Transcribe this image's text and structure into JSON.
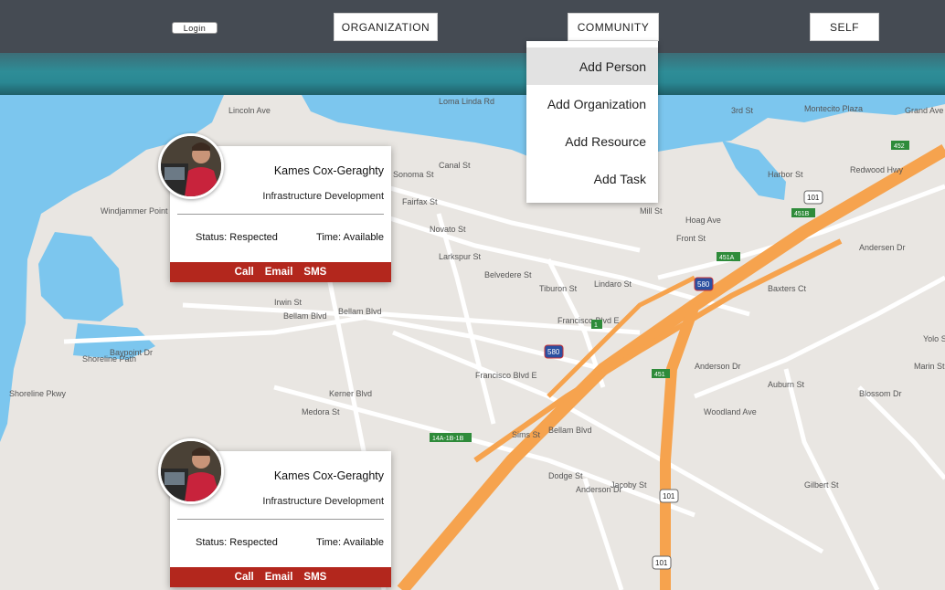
{
  "nav": {
    "self_label": "SELF",
    "community_label": "COMMUNITY",
    "organization_label": "ORGANIZATION",
    "login_label": "Login"
  },
  "community_menu": {
    "items": [
      "Add Person",
      "Add Organization",
      "Add Resource",
      "Add Task"
    ],
    "active_item": "Add Person"
  },
  "map": {
    "street_labels": [
      "Bellam Blvd",
      "Bellam Blvd",
      "Francisco Blvd E",
      "Francisco Blvd E",
      "Kerner Blvd",
      "Medora St",
      "Sims St",
      "Dodge St",
      "Jacoby St",
      "Anderson Dr",
      "Anderson Dr",
      "Andersen Dr",
      "Woodland Ave",
      "Auburn St",
      "Blossom Dr",
      "Gilbert St",
      "Baypoint Dr",
      "Shoreline Path",
      "Shoreline Pkwy",
      "Windjammer Point Dr",
      "Harbor St",
      "Mill St",
      "Front St",
      "Hoag Ave",
      "Lindaro St",
      "Belvedere St",
      "Tiburon St",
      "Larkspur St",
      "Novato St",
      "Fairfax St",
      "Sonoma St",
      "Canal St",
      "Irwin St",
      "Bellam Blvd",
      "3rd St",
      "Montecito Plaza",
      "Grand Ave",
      "Loma Linda Rd",
      "Baxters Ct",
      "Yolo St",
      "Marin St",
      "Redwood Hwy",
      "Lincoln Ave"
    ],
    "highway_shields": [
      "101",
      "101",
      "101",
      "580",
      "580"
    ],
    "exit_labels": [
      "451B",
      "451A",
      "451",
      "14A-1B-1B",
      "1",
      "452"
    ],
    "colors": {
      "water": "#7cc6ee",
      "land": "#e9e6e2",
      "highway": "#f6a34e",
      "road": "#ffffff"
    }
  },
  "cards": [
    {
      "name": "Kames Cox-Geraghty",
      "department": "Infrastructure Development",
      "time": "Time: Available",
      "status": "Status: Respected",
      "actions": {
        "call": "Call",
        "email": "Email",
        "sms": "SMS"
      }
    },
    {
      "name": "Kames Cox-Geraghty",
      "department": "Infrastructure Development",
      "time": "Time: Available",
      "status": "Status: Respected",
      "actions": {
        "call": "Call",
        "email": "Email",
        "sms": "SMS"
      }
    }
  ],
  "colors": {
    "topbar": "#454b53",
    "teal_band": "#2e8d97",
    "card_action_bar": "#b3271d"
  }
}
